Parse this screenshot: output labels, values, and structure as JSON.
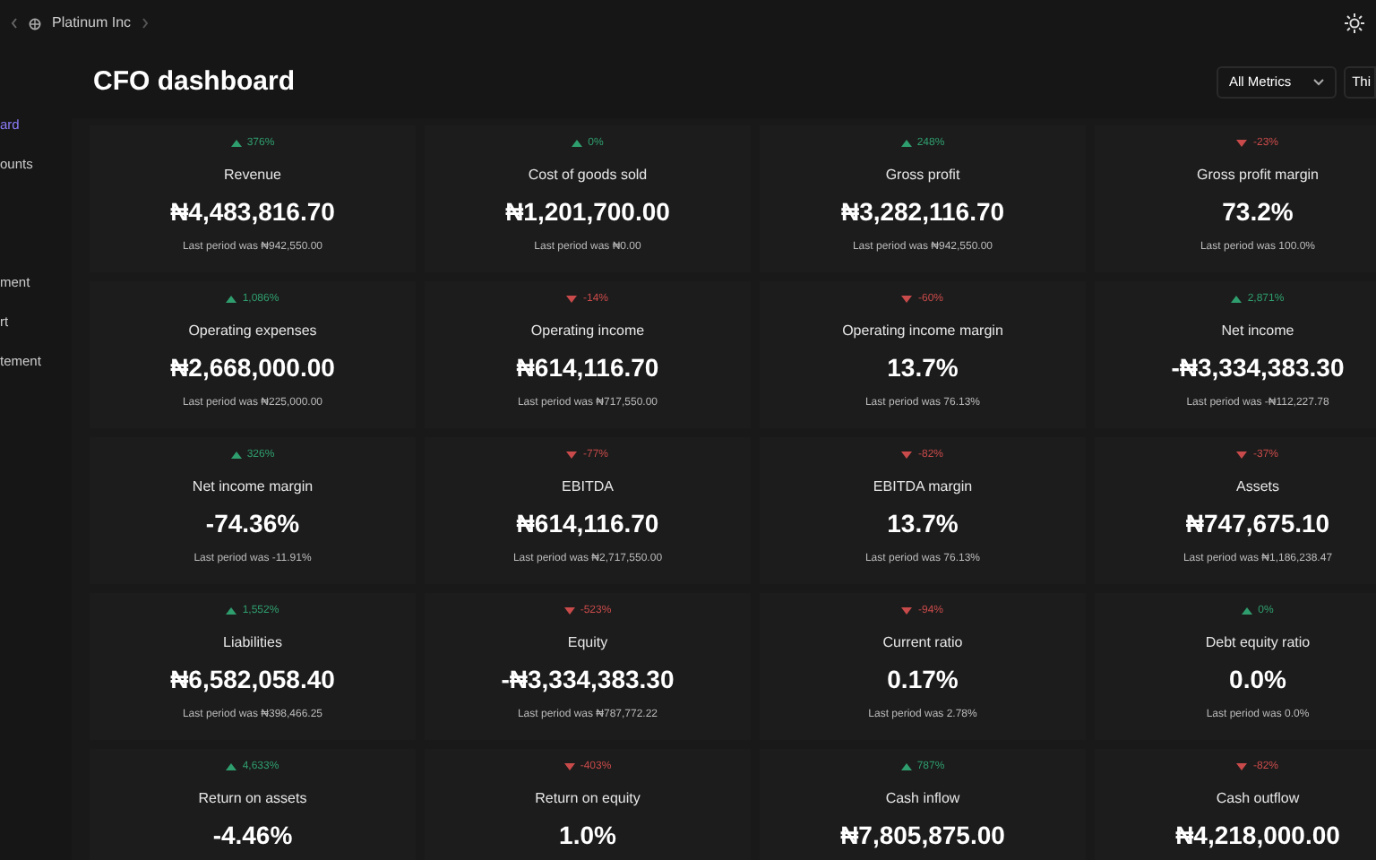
{
  "topbar": {
    "org": "Platinum Inc"
  },
  "sidebar": {
    "items": [
      {
        "label": "ard",
        "selected": true
      },
      {
        "label": "ounts",
        "selected": false
      },
      {
        "label": "ment",
        "selected": false
      },
      {
        "label": "rt",
        "selected": false
      },
      {
        "label": "tement",
        "selected": false
      }
    ]
  },
  "header": {
    "title": "CFO dashboard",
    "metric_filter": "All Metrics",
    "period_filter": "Thi"
  },
  "cards": [
    {
      "kind": "up",
      "change": "376%",
      "label": "Revenue",
      "value": "₦4,483,816.70",
      "last_period": "Last period was ₦942,550.00"
    },
    {
      "kind": "up",
      "change": "0%",
      "label": "Cost of goods sold",
      "value": "₦1,201,700.00",
      "last_period": "Last period was ₦0.00"
    },
    {
      "kind": "up",
      "change": "248%",
      "label": "Gross profit",
      "value": "₦3,282,116.70",
      "last_period": "Last period was ₦942,550.00"
    },
    {
      "kind": "down",
      "change": "-23%",
      "label": "Gross profit margin",
      "value": "73.2%",
      "last_period": "Last period was 100.0%"
    },
    {
      "kind": "up",
      "change": "1,086%",
      "label": "Operating expenses",
      "value": "₦2,668,000.00",
      "last_period": "Last period was ₦225,000.00"
    },
    {
      "kind": "down",
      "change": "-14%",
      "label": "Operating income",
      "value": "₦614,116.70",
      "last_period": "Last period was ₦717,550.00"
    },
    {
      "kind": "down",
      "change": "-60%",
      "label": "Operating income margin",
      "value": "13.7%",
      "last_period": "Last period was 76.13%"
    },
    {
      "kind": "up",
      "change": "2,871%",
      "label": "Net income",
      "value": "-₦3,334,383.30",
      "last_period": "Last period was -₦112,227.78"
    },
    {
      "kind": "up",
      "change": "326%",
      "label": "Net income margin",
      "value": "-74.36%",
      "last_period": "Last period was -11.91%"
    },
    {
      "kind": "down",
      "change": "-77%",
      "label": "EBITDA",
      "value": "₦614,116.70",
      "last_period": "Last period was ₦2,717,550.00"
    },
    {
      "kind": "down",
      "change": "-82%",
      "label": "EBITDA margin",
      "value": "13.7%",
      "last_period": "Last period was 76.13%"
    },
    {
      "kind": "down",
      "change": "-37%",
      "label": "Assets",
      "value": "₦747,675.10",
      "last_period": "Last period was ₦1,186,238.47"
    },
    {
      "kind": "up",
      "change": "1,552%",
      "label": "Liabilities",
      "value": "₦6,582,058.40",
      "last_period": "Last period was ₦398,466.25"
    },
    {
      "kind": "down",
      "change": "-523%",
      "label": "Equity",
      "value": "-₦3,334,383.30",
      "last_period": "Last period was ₦787,772.22"
    },
    {
      "kind": "down",
      "change": "-94%",
      "label": "Current ratio",
      "value": "0.17%",
      "last_period": "Last period was 2.78%"
    },
    {
      "kind": "up",
      "change": "0%",
      "label": "Debt equity ratio",
      "value": "0.0%",
      "last_period": "Last period was 0.0%"
    },
    {
      "kind": "up",
      "change": "4,633%",
      "label": "Return on assets",
      "value": "-4.46%"
    },
    {
      "kind": "down",
      "change": "-403%",
      "label": "Return on equity",
      "value": "1.0%"
    },
    {
      "kind": "up",
      "change": "787%",
      "label": "Cash inflow",
      "value": "₦7,805,875.00"
    },
    {
      "kind": "down",
      "change": "-82%",
      "label": "Cash outflow",
      "value": "₦4,218,000.00"
    }
  ]
}
